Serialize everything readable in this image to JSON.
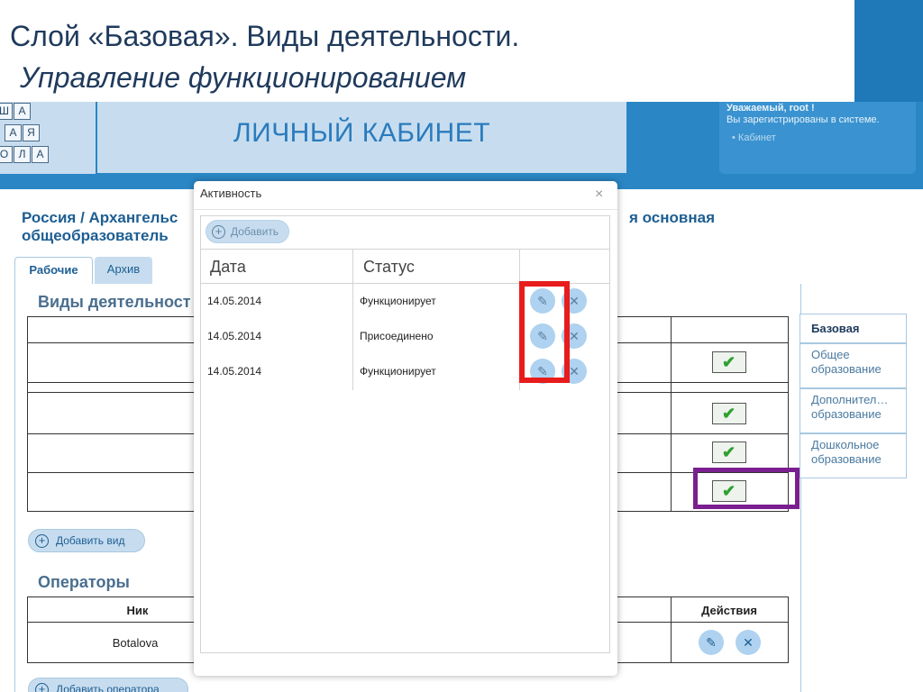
{
  "slide": {
    "title": "Слой «Базовая». Виды деятельности.",
    "subtitle": "Управление функционированием"
  },
  "header": {
    "logo_letters": [
      "Ш",
      "А",
      "А",
      "Я",
      "О",
      "Л",
      "А"
    ],
    "cabinet_title": "ЛИЧНЫЙ КАБИНЕТ",
    "greeting": "Уважаемый, root !",
    "registered": "Вы зарегистрированы в системе.",
    "cabinet_link": "Кабинет"
  },
  "breadcrumb": {
    "left_line1": "Россия / Архангельс",
    "left_line2": "общеобразователь",
    "right": "я основная"
  },
  "tabs": {
    "work": "Рабочие",
    "archive": "Архив"
  },
  "activities": {
    "title": "Виды деятельност",
    "add_label": "Добавить вид"
  },
  "layers": [
    "Базовая",
    "Общее образование",
    "Дополнител… образование",
    "Дошкольное образование"
  ],
  "operators": {
    "title": "Операторы",
    "col_nick": "Ник",
    "col_actions": "Действия",
    "rows": [
      {
        "nick": "Botalova"
      }
    ],
    "add_label": "Добавить оператора"
  },
  "modal": {
    "title": "Активность",
    "close": "×",
    "add_label": "Добавить",
    "col_date": "Дата",
    "col_status": "Статус",
    "rows": [
      {
        "date": "14.05.2014",
        "status": "Функционирует"
      },
      {
        "date": "14.05.2014",
        "status": "Присоединено"
      },
      {
        "date": "14.05.2014",
        "status": "Функционирует"
      }
    ]
  },
  "colors": {
    "header_blue": "#2a86c5",
    "light_blue": "#c7ddef",
    "highlight_red": "#e81c1c",
    "highlight_purple": "#7a1f8f",
    "check_green": "#2fa02f"
  },
  "icons": {
    "edit": "pencil-icon",
    "delete": "close-icon",
    "add": "plus-icon",
    "check": "checkmark-icon"
  }
}
